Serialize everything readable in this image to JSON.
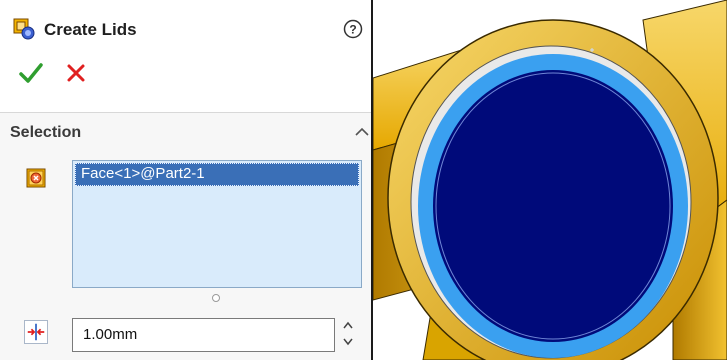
{
  "feature": {
    "title": "Create Lids",
    "icon": "create-lids-icon",
    "help_icon": "help-icon"
  },
  "actions": {
    "ok_icon": "checkmark-icon",
    "cancel_icon": "close-icon"
  },
  "selection": {
    "section_title": "Selection",
    "items": [
      "Face<1>@Part2-1"
    ]
  },
  "thickness": {
    "value": "1.00mm",
    "icon": "thickness-icon"
  },
  "colors": {
    "accent": "#3a6fb7",
    "list_bg": "#d9ebfb",
    "part_yellow": "#f2c230",
    "lid_blue": "#000a7a",
    "edge_blue": "#3aa0f0"
  }
}
